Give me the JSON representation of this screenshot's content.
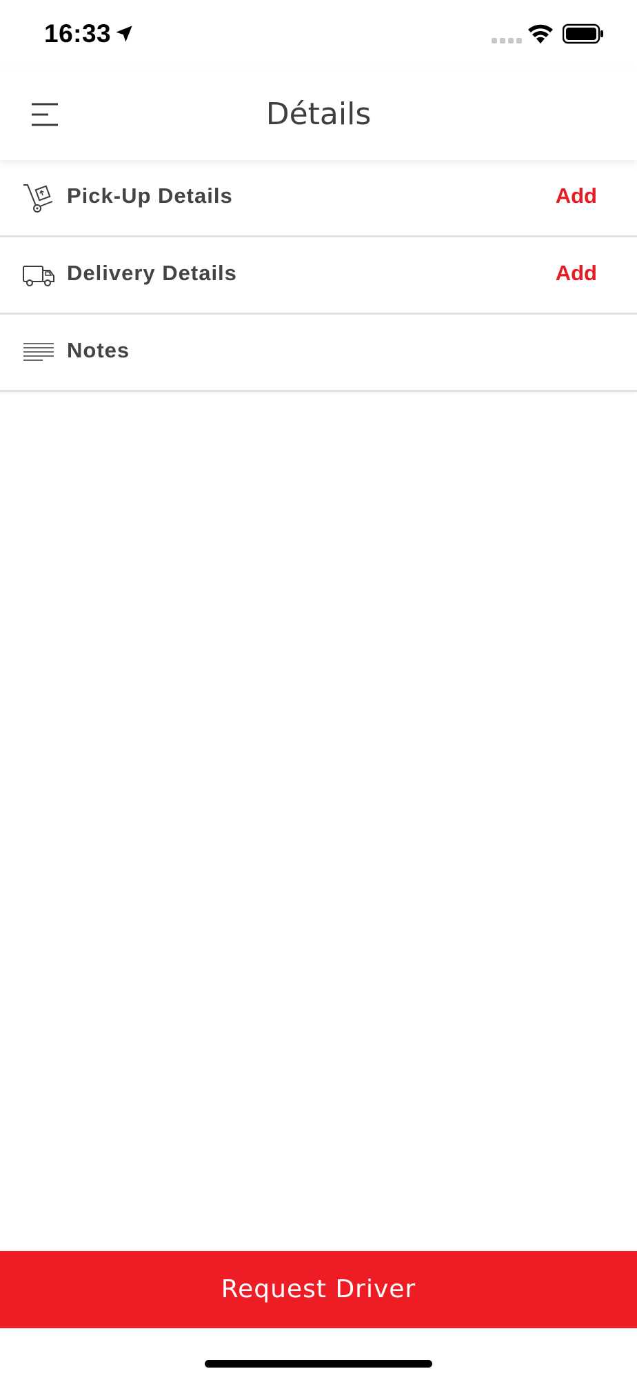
{
  "status_bar": {
    "time": "16:33"
  },
  "header": {
    "title": "Détails"
  },
  "rows": [
    {
      "label": "Pick-Up Details",
      "action": "Add",
      "icon": "hand-truck-icon"
    },
    {
      "label": "Delivery Details",
      "action": "Add",
      "icon": "truck-icon"
    },
    {
      "label": "Notes",
      "action": "",
      "icon": "notes-lines-icon"
    }
  ],
  "footer": {
    "button_label": "Request Driver"
  },
  "colors": {
    "accent": "#ee1c25",
    "action_text": "#e41c24",
    "divider": "#e2e2e2"
  }
}
